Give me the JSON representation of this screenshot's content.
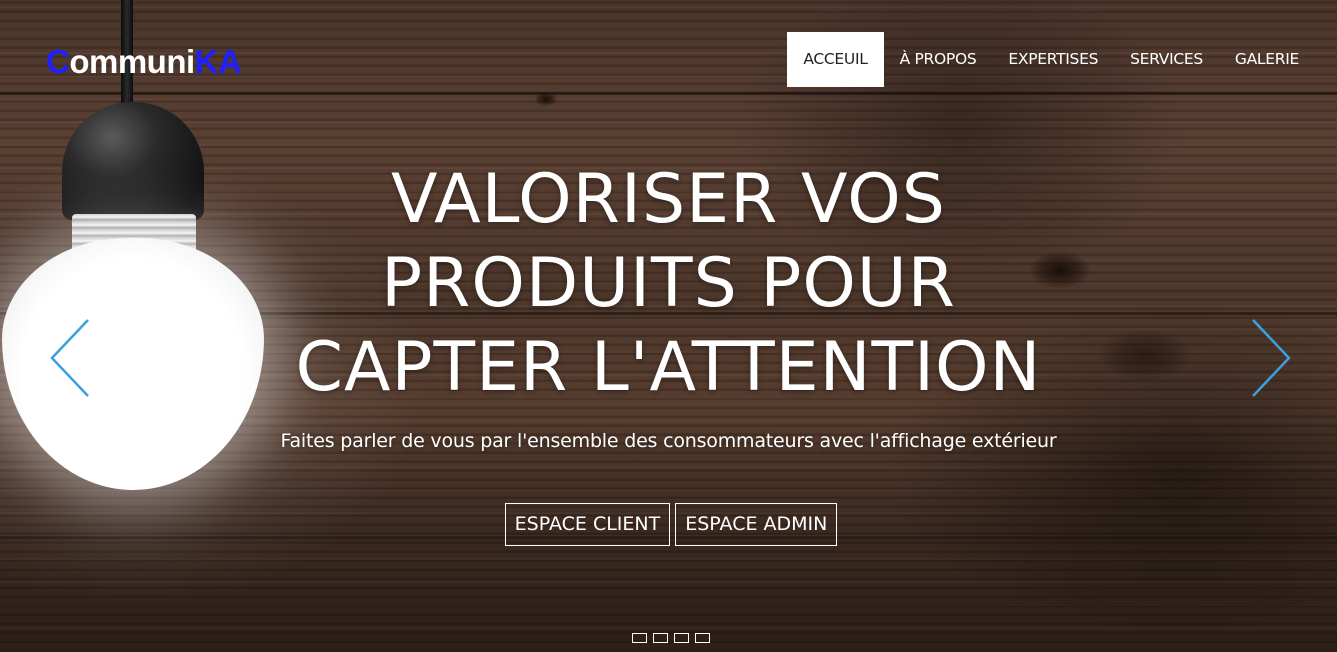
{
  "brand": {
    "logo_c": "C",
    "logo_mid": "ommuni",
    "logo_ka": "KA"
  },
  "nav": {
    "items": [
      {
        "label": "ACCEUIL",
        "active": true
      },
      {
        "label": "À PROPOS",
        "active": false
      },
      {
        "label": "EXPERTISES",
        "active": false
      },
      {
        "label": "SERVICES",
        "active": false
      },
      {
        "label": "GALERIE",
        "active": false
      }
    ]
  },
  "hero": {
    "headline_lines": [
      "VALORISER VOS",
      "PRODUITS POUR",
      "CAPTER L'ATTENTION"
    ],
    "subtitle": "Faites parler de vous par l'ensemble des consommateurs avec l'affichage extérieur",
    "buttons": {
      "client": "ESPACE CLIENT",
      "admin": "ESPACE ADMIN"
    }
  },
  "carousel": {
    "prev_icon": "chevron-left-icon",
    "next_icon": "chevron-right-icon",
    "indicator_count": 4,
    "active_indicator": 1
  },
  "colors": {
    "logo_blue": "#2020ff",
    "arrow_blue": "#3aa0e0",
    "text": "#ffffff",
    "active_nav_bg": "#ffffff",
    "active_nav_text": "#222222"
  }
}
